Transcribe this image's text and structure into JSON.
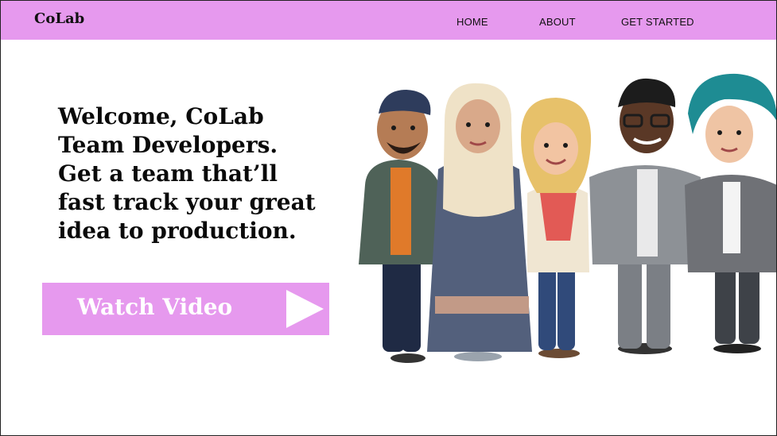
{
  "nav": {
    "brand": "CoLab",
    "links": [
      {
        "label": "HOME"
      },
      {
        "label": "ABOUT"
      },
      {
        "label": "GET STARTED"
      }
    ]
  },
  "hero": {
    "headline": "Welcome, CoLab Team Developers. Get a team that’ll fast track your great idea to production.",
    "cta_label": "Watch Video",
    "cta_icon": "play-icon"
  },
  "colors": {
    "accent": "#e699ee",
    "text": "#0a0a0a",
    "button_text": "#ffffff"
  },
  "illustration": {
    "icon": "team-avatars-illustration"
  }
}
